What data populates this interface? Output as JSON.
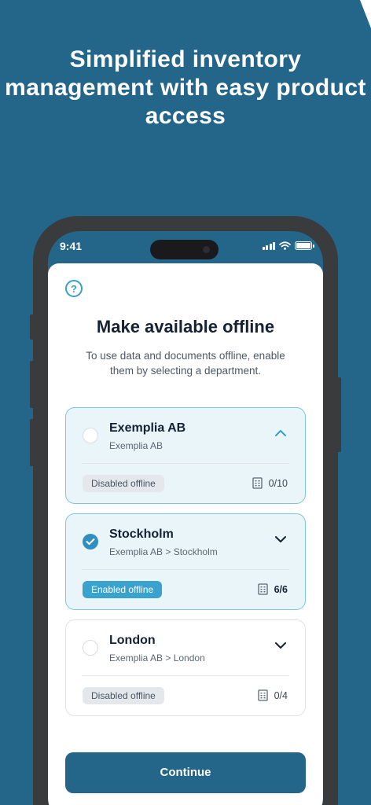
{
  "headline": "Simplified inventory management with easy product access",
  "status_bar": {
    "time": "9:41"
  },
  "sheet": {
    "title": "Make available offline",
    "subtitle": "To use data and documents offline, enable them by selecting a department."
  },
  "departments": [
    {
      "name": "Exemplia AB",
      "path": "Exemplia AB",
      "status": "Disabled offline",
      "count": "0/10",
      "selected": false,
      "expanded": true
    },
    {
      "name": "Stockholm",
      "path": "Exemplia AB > Stockholm",
      "status": "Enabled offline",
      "count": "6/6",
      "selected": true,
      "expanded": false
    },
    {
      "name": "London",
      "path": "Exemplia AB > London",
      "status": "Disabled offline",
      "count": "0/4",
      "selected": false,
      "expanded": false
    }
  ],
  "continue_label": "Continue",
  "colors": {
    "background": "#24658A",
    "accent": "#3aa3cd",
    "button": "#24658A"
  }
}
